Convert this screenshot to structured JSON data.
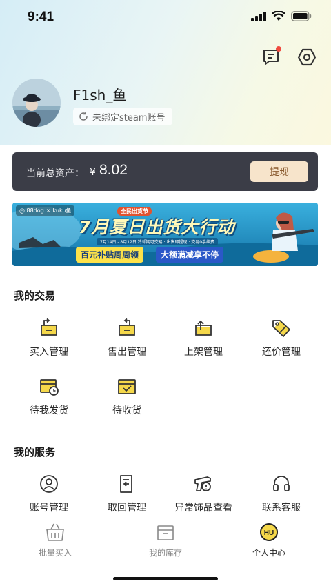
{
  "status_bar": {
    "time": "9:41"
  },
  "header": {
    "message_icon": "message-icon",
    "settings_icon": "settings-hex-icon"
  },
  "profile": {
    "username": "F1sh_鱼",
    "bind_text": "未绑定steam账号"
  },
  "assets": {
    "label": "当前总资产：",
    "currency": "¥",
    "value": "8.02",
    "withdraw_label": "提现"
  },
  "banner": {
    "brands": [
      "@ 88dog",
      "×",
      "kuku鱼"
    ],
    "kicker": "全民出货节",
    "headline": "7月夏日出货大行动",
    "subline": "7月14日 - 8月12日   冷却期可交易 · 出售即提现 · 交易0手续费",
    "tag_left": "百元补贴周周领",
    "tag_right": "大额满减享不停"
  },
  "trade": {
    "title": "我的交易",
    "items": [
      {
        "label": "买入管理",
        "icon": "buy-manage-icon"
      },
      {
        "label": "售出管理",
        "icon": "sell-manage-icon"
      },
      {
        "label": "上架管理",
        "icon": "listing-manage-icon"
      },
      {
        "label": "还价管理",
        "icon": "counter-offer-icon"
      },
      {
        "label": "待我发货",
        "icon": "pending-ship-icon"
      },
      {
        "label": "待收货",
        "icon": "pending-receive-icon"
      }
    ]
  },
  "services": {
    "title": "我的服务",
    "items": [
      {
        "label": "账号管理",
        "icon": "account-icon"
      },
      {
        "label": "取回管理",
        "icon": "retrieve-icon"
      },
      {
        "label": "异常饰品查看",
        "icon": "abnormal-item-icon"
      },
      {
        "label": "联系客服",
        "icon": "headset-icon"
      }
    ]
  },
  "tabbar": {
    "items": [
      {
        "label": "批量买入",
        "icon": "basket-icon"
      },
      {
        "label": "我的库存",
        "icon": "inventory-box-icon"
      },
      {
        "label": "个人中心",
        "icon": "hu-badge-icon"
      }
    ],
    "active": "个人中心"
  },
  "colors": {
    "accent_yellow": "#f5d84a",
    "asset_card": "#3b3d47",
    "withdraw_bg": "#f7e4cb",
    "badge_red": "#f04a3e"
  }
}
